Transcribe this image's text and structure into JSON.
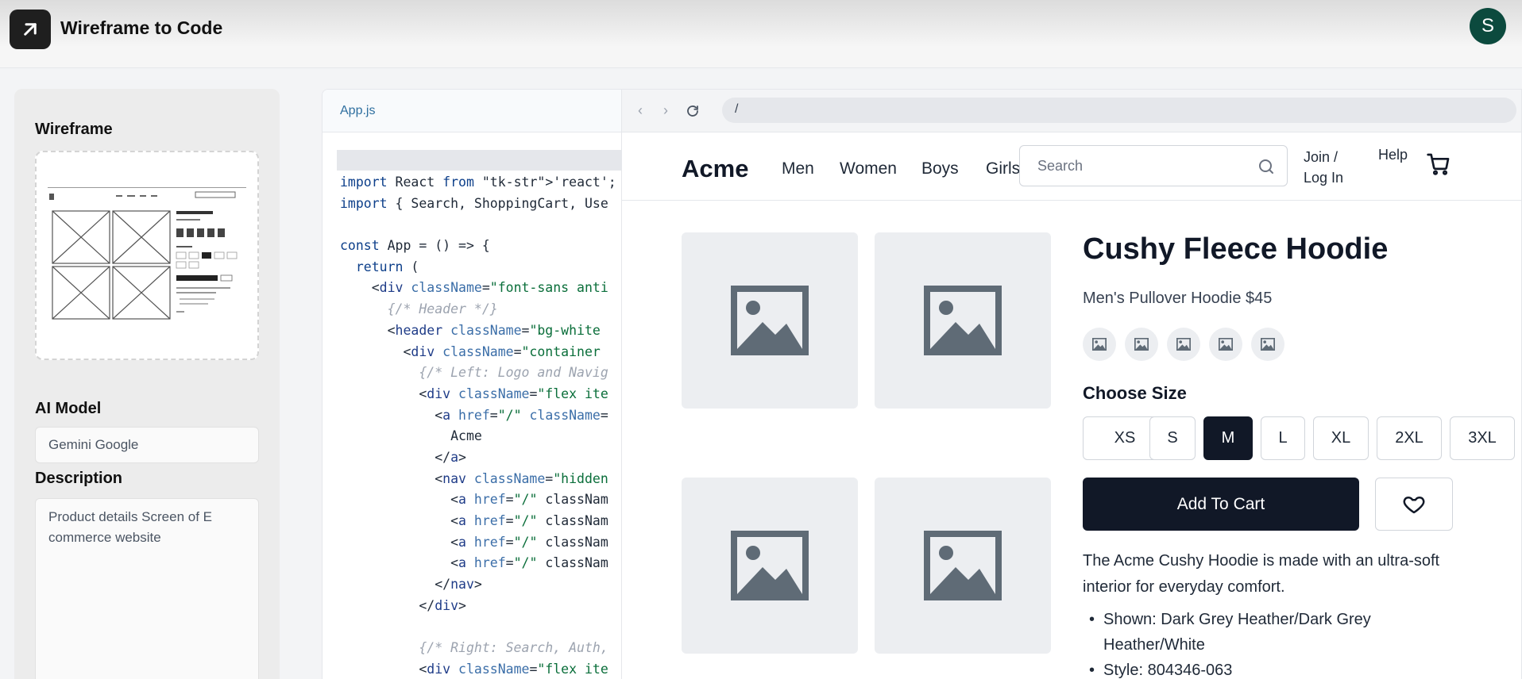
{
  "app": {
    "title": "Wireframe to Code",
    "user_initial": "S",
    "logo_icon": "arrow-up-right-icon"
  },
  "sidebar": {
    "wireframe_label": "Wireframe",
    "model_label": "AI Model",
    "model_value": "Gemini Google",
    "description_label": "Description",
    "description_value": "Product details Screen of E commerce website"
  },
  "editor": {
    "filename": "App.js",
    "lines": [
      "import React from 'react';",
      "import { Search, ShoppingCart, Use",
      "",
      "const App = () => {",
      "  return (",
      "    <div className=\"font-sans anti",
      "      {/* Header */}",
      "      <header className=\"bg-white",
      "        <div className=\"container",
      "          {/* Left: Logo and Navig",
      "          <div className=\"flex ite",
      "            <a href=\"/\" className=",
      "              Acme",
      "            </a>",
      "            <nav className=\"hidden",
      "              <a href=\"/\" classNam",
      "              <a href=\"/\" classNam",
      "              <a href=\"/\" classNam",
      "              <a href=\"/\" classNam",
      "            </nav>",
      "          </div>",
      "",
      "          {/* Right: Search, Auth,",
      "          <div className=\"flex ite"
    ]
  },
  "browser": {
    "url": "/"
  },
  "site": {
    "brand": "Acme",
    "nav": [
      "Men",
      "Women",
      "Boys",
      "Girls"
    ],
    "search_placeholder": "Search",
    "join": "Join /\nLog In",
    "help": "Help"
  },
  "product": {
    "title": "Cushy Fleece Hoodie",
    "subtitle": "Men's Pullover Hoodie $45",
    "choose_size_label": "Choose Size",
    "sizes": [
      "XS",
      "S",
      "M",
      "L",
      "XL",
      "2XL",
      "3XL"
    ],
    "selected_size": "M",
    "add_to_cart": "Add To Cart",
    "description": "The Acme Cushy Hoodie is made with an ultra-soft interior for everyday comfort.",
    "bullets": [
      "Shown: Dark Grey Heather/Dark Grey Heather/White",
      "Style: 804346-063"
    ]
  },
  "colors": {
    "primary": "#111827",
    "avatar": "#0c4a3e",
    "placeholder_bg": "#eceef1",
    "placeholder_icon": "#5f6b76"
  }
}
